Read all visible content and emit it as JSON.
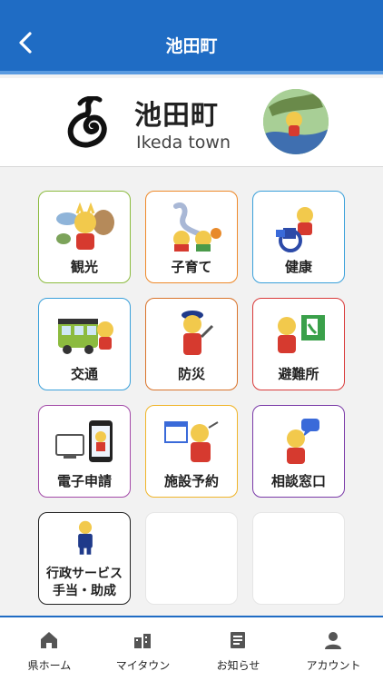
{
  "header": {
    "title": "池田町"
  },
  "town": {
    "name": "池田町",
    "roman": "Ikeda town"
  },
  "tiles": [
    {
      "label": "観光",
      "border": "#8cbb3f"
    },
    {
      "label": "子育て",
      "border": "#ee8a2b"
    },
    {
      "label": "健康",
      "border": "#3aa0da"
    },
    {
      "label": "交通",
      "border": "#3aa0da"
    },
    {
      "label": "防災",
      "border": "#d9742b"
    },
    {
      "label": "避難所",
      "border": "#d93a3a"
    },
    {
      "label": "電子申請",
      "border": "#a34aa8"
    },
    {
      "label": "施設予約",
      "border": "#f0b52a"
    },
    {
      "label": "相談窓口",
      "border": "#7a3aa8"
    },
    {
      "label": "行政サービス",
      "label_line2": "手当・助成",
      "border": "#222222"
    }
  ],
  "tabs": [
    {
      "label": "県ホーム",
      "icon": "home-icon"
    },
    {
      "label": "マイタウン",
      "icon": "town-icon"
    },
    {
      "label": "お知らせ",
      "icon": "news-icon"
    },
    {
      "label": "アカウント",
      "icon": "account-icon"
    }
  ],
  "colors": {
    "brand": "#1f6cc4"
  }
}
